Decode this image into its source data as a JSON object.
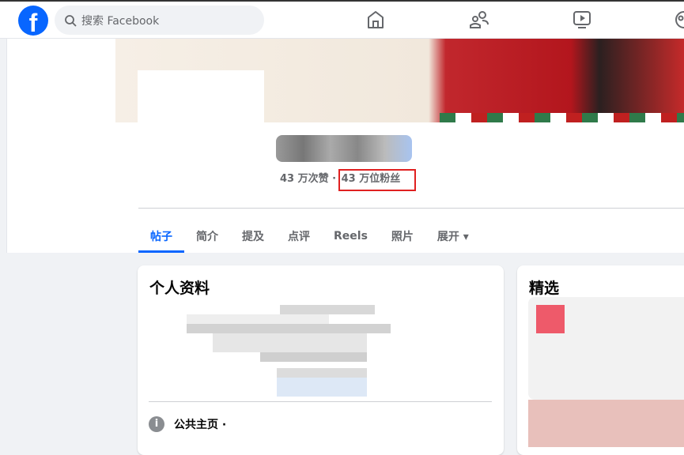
{
  "topbar": {
    "logo": "f",
    "search_placeholder": "搜索 Facebook",
    "nav_icons": [
      "home-icon",
      "friends-icon",
      "video-icon",
      "groups-icon"
    ]
  },
  "profile": {
    "likes": "43 万次赞",
    "separator": " · ",
    "followers": "43 万位粉丝"
  },
  "tabs": [
    {
      "label": "帖子",
      "active": true
    },
    {
      "label": "简介"
    },
    {
      "label": "提及"
    },
    {
      "label": "点评"
    },
    {
      "label": "Reels"
    },
    {
      "label": "照片"
    },
    {
      "label": "展开 ▾"
    }
  ],
  "intro_card": {
    "title": "个人资料",
    "info_label": "公共主页 · "
  },
  "featured_card": {
    "title": "精选"
  },
  "colors": {
    "brand": "#0866ff",
    "highlight_box": "#e02020"
  }
}
